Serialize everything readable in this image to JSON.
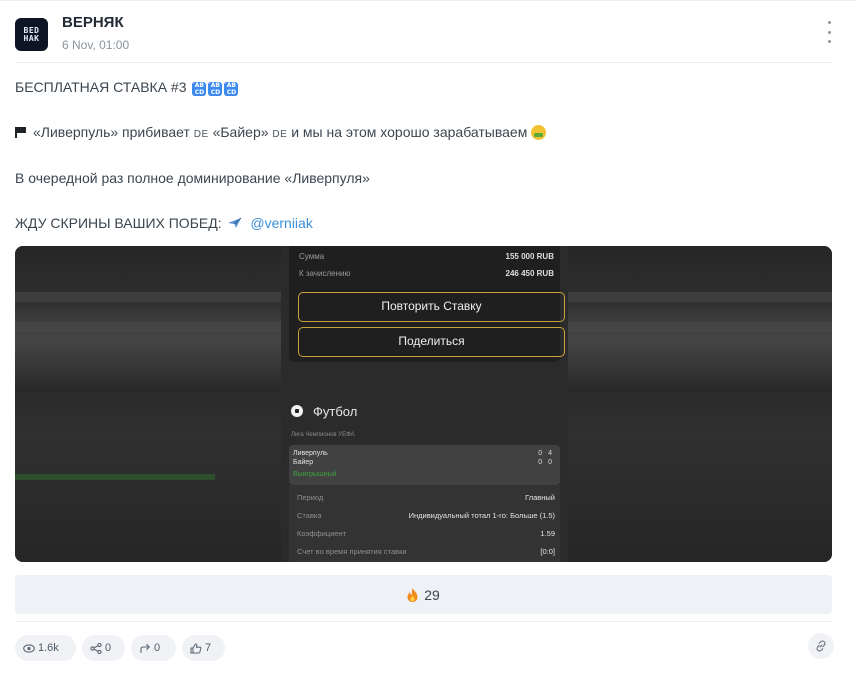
{
  "channel": {
    "name": "ВЕРНЯК",
    "date": "6 Nov, 01:00",
    "avatar_text": [
      "BED",
      "HAK"
    ]
  },
  "post": {
    "line1": "БЕСПЛАТНАЯ СТАВКА #3",
    "ab_icon_text": "AB\nCD",
    "line2_a": "«Ливерпуль» прибивает",
    "line2_de1": "DE",
    "line2_b": "«Байер»",
    "line2_de2": "DE",
    "line2_c": "и мы на этом хорошо зарабатываем",
    "line3": "В очередной раз полное доминирование «Ливерпуля»",
    "line4": "ЖДУ СКРИНЫ ВАШИХ ПОБЕД:",
    "mention": "@verniiak"
  },
  "bet_screenshot": {
    "sum_label": "Сумма",
    "sum_value": "155 000 RUB",
    "payout_label": "К зачислению",
    "payout_value": "246 450 RUB",
    "repeat_button": "Повторить Ставку",
    "share_button": "Поделиться",
    "sport": "Футбол",
    "league": "Лига Чемпионов УЕФА",
    "team1": "Ливерпуль",
    "team2": "Байер",
    "score1": "0 4",
    "score2": "0 0",
    "status": "Выигрышный",
    "details": [
      {
        "label": "Период",
        "value": "Главный"
      },
      {
        "label": "Ставка",
        "value": "Индивидуальный тотал 1-го: Больше (1.5)"
      },
      {
        "label": "Коэффициент",
        "value": "1.59"
      },
      {
        "label": "Счет во время принятия ставки",
        "value": "[0:0]"
      }
    ]
  },
  "reaction": {
    "icon": "fire-icon",
    "count": "29"
  },
  "stats": {
    "views": "1.6k",
    "shares": "0",
    "reposts": "0",
    "likes": "7"
  },
  "colors": {
    "accent": "#3a8fd8",
    "reaction_bg": "#eef1f6",
    "button_border": "#c9a43c",
    "win_green": "#3fa23f"
  }
}
